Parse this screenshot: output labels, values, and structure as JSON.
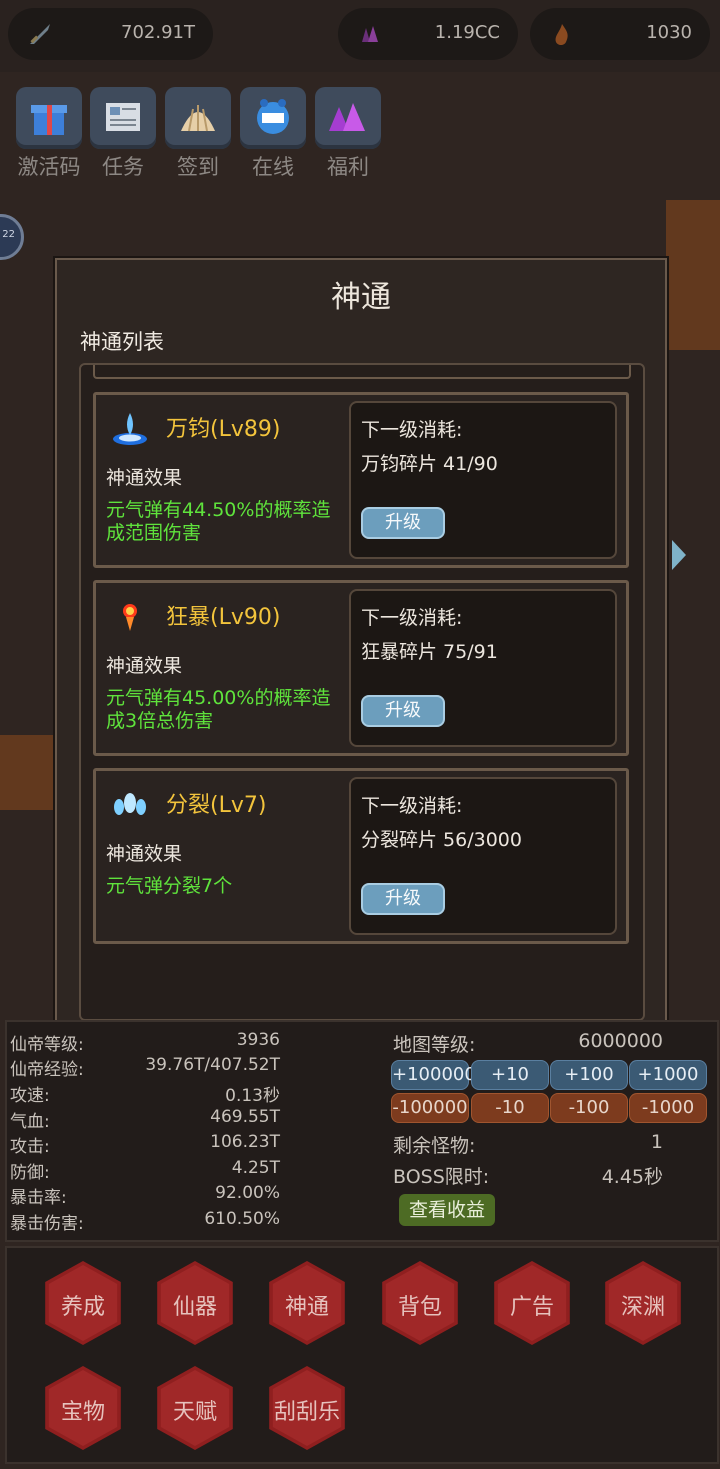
{
  "resources": [
    {
      "icon": "sword-icon",
      "value": "702.91T"
    },
    {
      "icon": "crystal-icon",
      "value": "1.19CC"
    },
    {
      "icon": "fire-icon",
      "value": "1030"
    }
  ],
  "features": [
    {
      "icon": "gift-icon",
      "label": "激活码"
    },
    {
      "icon": "newspaper-icon",
      "label": "任务"
    },
    {
      "icon": "shell-icon",
      "label": "签到"
    },
    {
      "icon": "clock-icon",
      "label": "在线"
    },
    {
      "icon": "gem-icon",
      "label": "福利"
    }
  ],
  "side_badge": "22",
  "modal": {
    "title": "神通",
    "list_title": "神通列表",
    "effect_label": "神通效果",
    "cost_label": "下一级消耗:",
    "upgrade_label": "升级",
    "skills": [
      {
        "icon": "vortex-icon",
        "name": "万钧(Lv89)",
        "desc": "元气弹有44.50%的概率造成范围伤害",
        "cost": "万钧碎片 41/90"
      },
      {
        "icon": "flame-orb-icon",
        "name": "狂暴(Lv90)",
        "desc": "元气弹有45.00%的概率造成3倍总伤害",
        "cost": "狂暴碎片 75/91"
      },
      {
        "icon": "split-orb-icon",
        "name": "分裂(Lv7)",
        "desc": "元气弹分裂7个",
        "cost": "分裂碎片 56/3000"
      }
    ]
  },
  "stats": {
    "rows": [
      {
        "k": "仙帝等级:",
        "v": "3936"
      },
      {
        "k": "仙帝经验:",
        "v": "39.76T/407.52T"
      },
      {
        "k": "攻速:",
        "v": "0.13秒"
      },
      {
        "k": "气血:",
        "v": "469.55T"
      },
      {
        "k": "攻击:",
        "v": "106.23T"
      },
      {
        "k": "防御:",
        "v": "4.25T"
      },
      {
        "k": "暴击率:",
        "v": "92.00%"
      },
      {
        "k": "暴击伤害:",
        "v": "610.50%"
      }
    ],
    "map_level": {
      "k": "地图等级:",
      "v": "6000000"
    },
    "plus_buttons": [
      "+100000",
      "+10",
      "+100",
      "+1000"
    ],
    "minus_buttons": [
      "-100000",
      "-10",
      "-100",
      "-1000"
    ],
    "remaining": {
      "k": "剩余怪物:",
      "v": "1"
    },
    "boss": {
      "k": "BOSS限时:",
      "v": "4.45秒"
    },
    "view_label": "查看收益"
  },
  "nav": [
    "养成",
    "仙器",
    "神通",
    "背包",
    "广告",
    "深渊",
    "宝物",
    "天赋",
    "刮刮乐"
  ]
}
